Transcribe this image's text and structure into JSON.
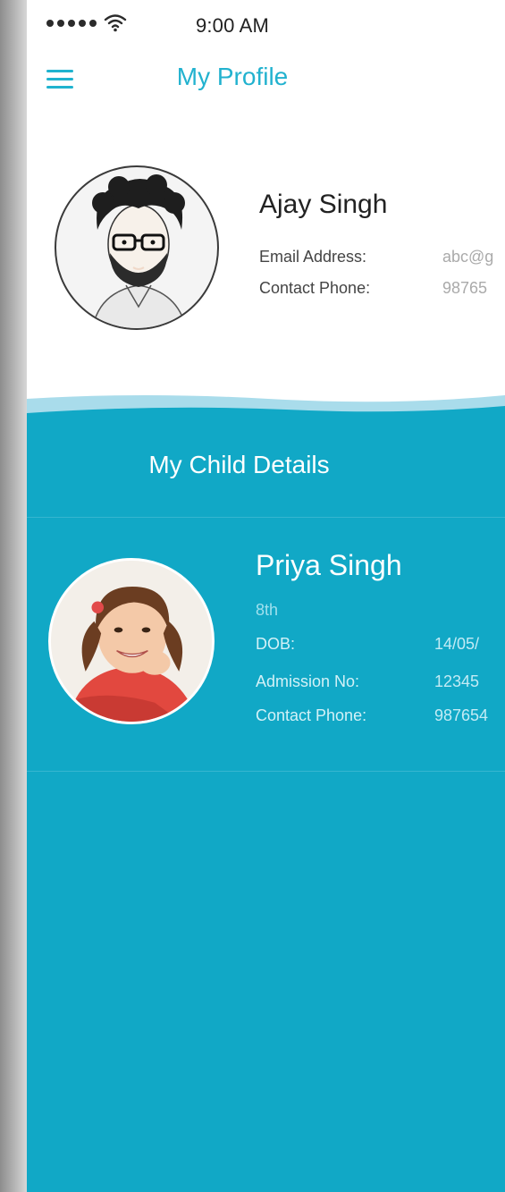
{
  "status_bar": {
    "time": "9:00 AM"
  },
  "navbar": {
    "title": "My Profile"
  },
  "profile": {
    "name": "Ajay Singh",
    "email_label": "Email Address:",
    "email_value": "abc@g",
    "phone_label": "Contact Phone:",
    "phone_value": "98765"
  },
  "child_section": {
    "title": "My Child Details",
    "child": {
      "name": "Priya Singh",
      "class": "8th",
      "dob_label": "DOB:",
      "dob_value": "14/05/",
      "admission_label": "Admission No:",
      "admission_value": "12345",
      "phone_label": "Contact Phone:",
      "phone_value": "987654"
    }
  },
  "colors": {
    "accent": "#22b2cf",
    "section_bg": "#11a8c6"
  },
  "icons": {
    "menu": "hamburger-menu-icon",
    "wifi": "wifi-icon",
    "signal": "signal-dots-icon"
  }
}
